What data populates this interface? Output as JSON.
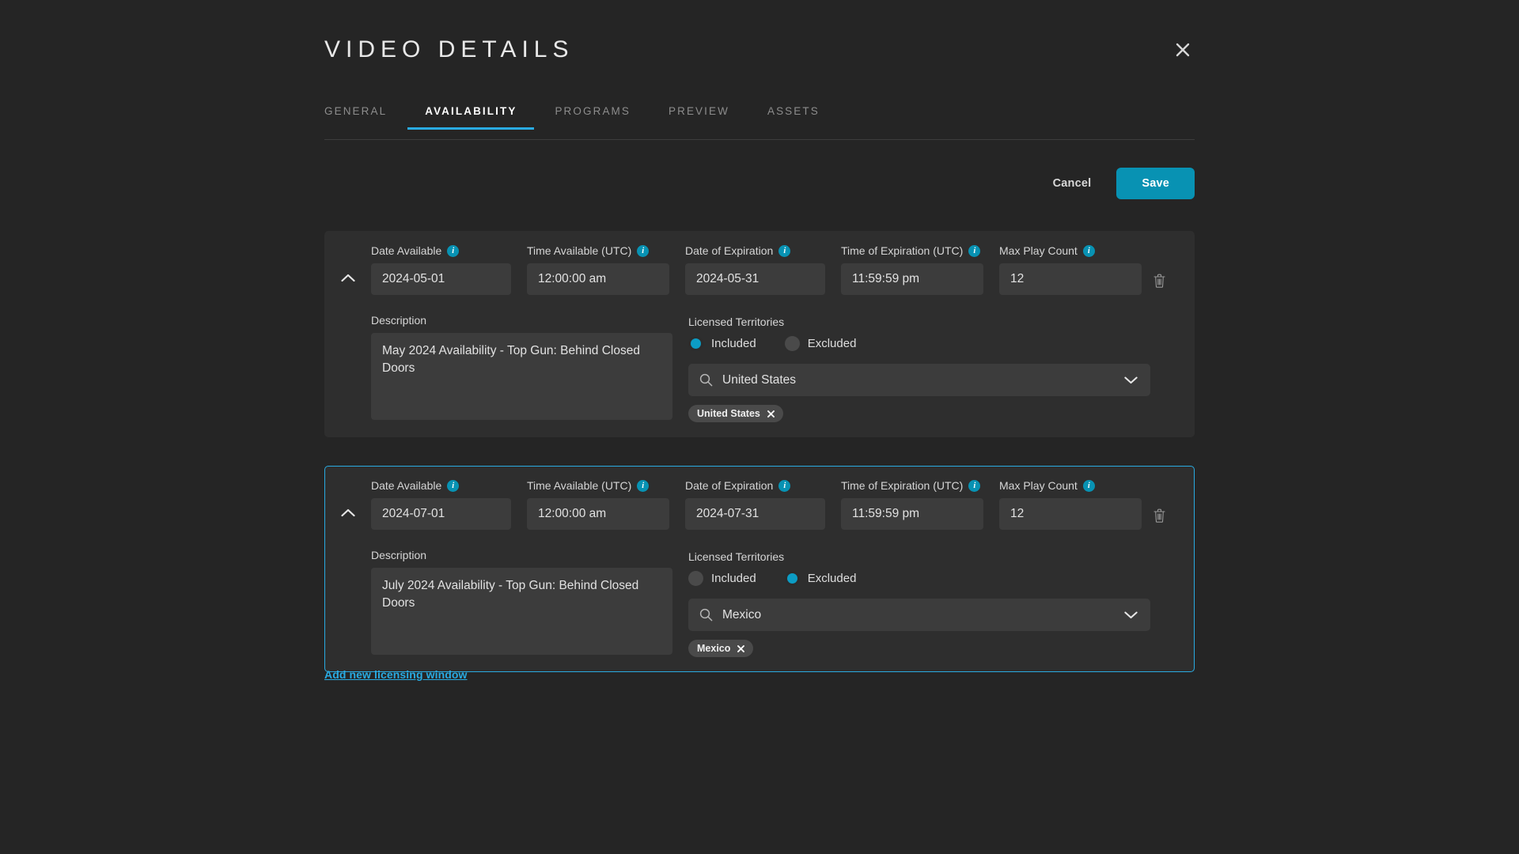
{
  "header": {
    "title": "VIDEO DETAILS",
    "close_icon": "close-icon"
  },
  "tabs": [
    {
      "label": "GENERAL",
      "active": false
    },
    {
      "label": "AVAILABILITY",
      "active": true
    },
    {
      "label": "PROGRAMS",
      "active": false
    },
    {
      "label": "PREVIEW",
      "active": false
    },
    {
      "label": "ASSETS",
      "active": false
    }
  ],
  "actions": {
    "cancel_label": "Cancel",
    "save_label": "Save",
    "save_color": "#0892b3"
  },
  "labels": {
    "date_available": "Date Available",
    "time_available": "Time Available (UTC)",
    "date_expiration": "Date of Expiration",
    "time_expiration": "Time of Expiration (UTC)",
    "max_play_count": "Max Play Count",
    "description": "Description",
    "licensed_territories": "Licensed Territories",
    "included": "Included",
    "excluded": "Excluded"
  },
  "windows": [
    {
      "selected": false,
      "date_available": "2024-05-01",
      "time_available": "12:00:00 am",
      "date_expiration": "2024-05-31",
      "time_expiration": "11:59:59 pm",
      "max_play_count": "12",
      "description": "May 2024 Availability - Top Gun: Behind Closed Doors",
      "territory_mode": "Included",
      "territory_search": "United States",
      "chips": [
        {
          "label": "United States"
        }
      ]
    },
    {
      "selected": true,
      "date_available": "2024-07-01",
      "time_available": "12:00:00 am",
      "date_expiration": "2024-07-31",
      "time_expiration": "11:59:59 pm",
      "max_play_count": "12",
      "description": "July 2024 Availability - Top Gun: Behind Closed Doors",
      "territory_mode": "Excluded",
      "territory_search": "Mexico",
      "chips": [
        {
          "label": "Mexico"
        }
      ]
    }
  ],
  "add_link": {
    "label": "Add new licensing window",
    "color": "#29abe2"
  },
  "colors": {
    "page_bg": "#252525",
    "panel_bg": "#2e2e2e",
    "input_bg": "#3c3c3c",
    "accent": "#29abe2",
    "accent_deep": "#0892b3"
  }
}
